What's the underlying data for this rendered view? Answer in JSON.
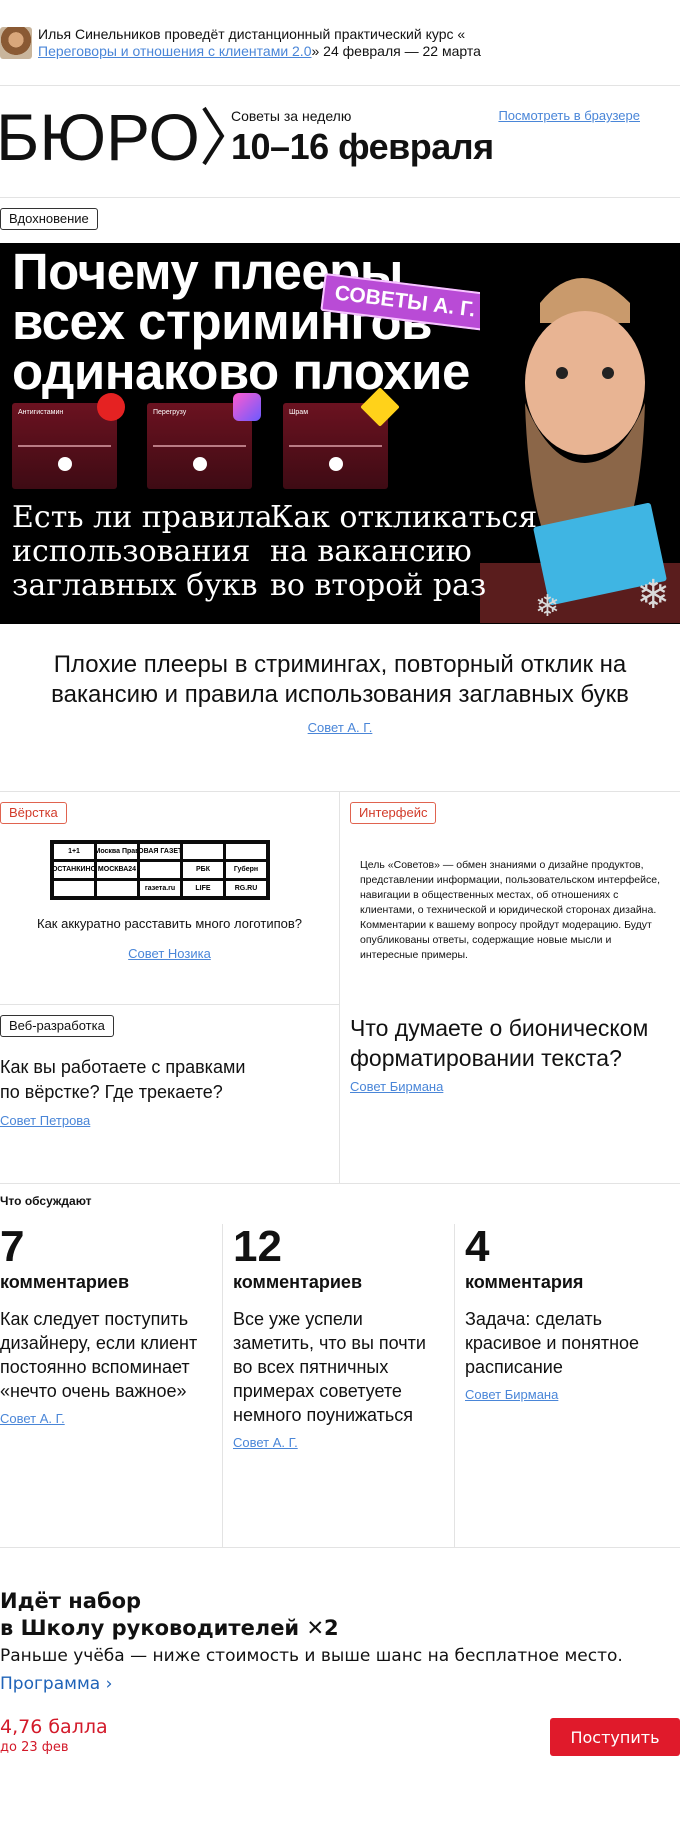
{
  "promo": {
    "text_before": "Илья Синельников проведёт дистанционный практический курс «",
    "course_link": "Переговоры и отношения с клиентами 2.0",
    "text_after": "» 24 февраля — 22 марта"
  },
  "masthead": {
    "logo": "БЮРО",
    "subtitle": "Советы за неделю",
    "dates": "10–16 февраля",
    "browser_link": "Посмотреть в браузере"
  },
  "hero": {
    "tag": "Вдохновение",
    "title_lines": [
      "Почему плееры",
      "всех стримингов",
      "одинаково плохие"
    ],
    "sticker": "СОВЕТЫ А. Г.",
    "sub_left": [
      "Есть ли правила",
      "использования",
      "заглавных букв"
    ],
    "sub_right": [
      "Как откликаться",
      "на вакансию",
      "во второй раз"
    ],
    "phones": [
      "Антигистамин",
      "Перегрузу",
      "Шрам"
    ]
  },
  "intro": {
    "title": "Плохие плееры в стримингах, повторный отклик на вакансию и правила использования заглавных букв",
    "link": "Совет А. Г."
  },
  "cards": {
    "layout": {
      "tag": "Вёрстка",
      "logos": [
        "1+1",
        "Москва Прав",
        "НОВАЯ ГАЗЕТА",
        "",
        "",
        "ОСТАНКИНО",
        "МОСКВА24",
        "",
        "РБК",
        "Губерн",
        "",
        "",
        "газета.ru",
        "LIFE",
        "RG.RU"
      ],
      "caption": "Как аккуратно расставить много логотипов?",
      "link": "Совет Нозика"
    },
    "interface": {
      "tag": "Интерфейс",
      "text": "Цель «Советов» — обмен знаниями о дизайне продуктов, представлении информации, пользовательском интерфейсе, навигации в общественных местах, об отношениях с клиентами, о технической и юридической сторонах дизайна. Комментарии к вашему вопросу пройдут модерацию. Будут опубликованы ответы, содержащие новые мысли и интересные примеры."
    },
    "web": {
      "tag": "Веб-разработка",
      "question": "Как вы работаете с правками по вёрстке? Где трекаете?",
      "link": "Совет Петрова"
    },
    "bionic": {
      "question": "Что думаете о бионическом форматировании текста?",
      "link": "Совет Бирмана"
    }
  },
  "discussions": {
    "heading": "Что обсуждают",
    "items": [
      {
        "count": "7",
        "word": "комментариев",
        "text": "Как следует поступить дизайнеру, если клиент постоянно вспоминает «нечто очень важное»",
        "link": "Совет А. Г."
      },
      {
        "count": "12",
        "word": "комментариев",
        "text": "Все уже успели заметить, что вы почти во всех пятничных примерах советуете немного поунижаться",
        "link": "Совет А. Г."
      },
      {
        "count": "4",
        "word": "комментария",
        "text": "Задача: сделать красивое и понятное расписание",
        "link": "Совет Бирмана"
      }
    ]
  },
  "school": {
    "title_line1": "Идёт набор",
    "title_line2": "в Школу руководителей ✕2",
    "subtitle": "Раньше учёба — ниже стоимость и выше шанс на бесплатное место.",
    "program_link": "Программа ›",
    "price": "4,76 балла",
    "deadline": "до 23 фев",
    "apply_button": "Поступить"
  },
  "colors": {
    "link": "#4a86d8",
    "accent_red": "#e01a2b",
    "hero_bg": "#000000",
    "sticker": "#b94bd6"
  }
}
